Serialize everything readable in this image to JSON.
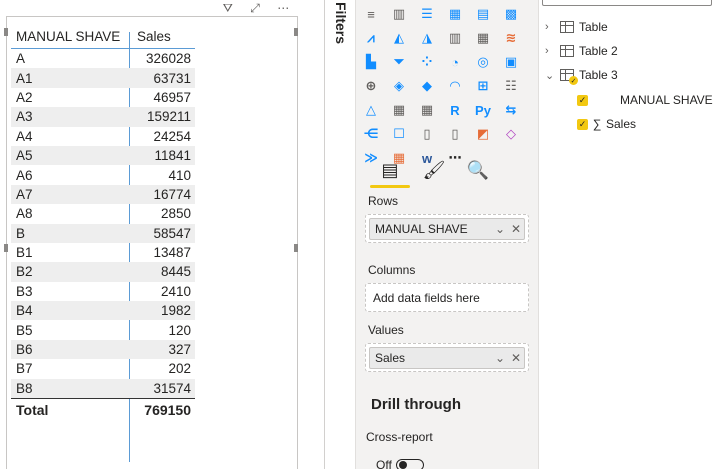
{
  "visual": {
    "header_icons": [
      {
        "icon": "filter-icon",
        "glyph": "⛛"
      },
      {
        "icon": "focus-mode-icon",
        "glyph": "⤢"
      },
      {
        "icon": "more-options-icon",
        "glyph": "⋯"
      }
    ]
  },
  "table": {
    "columns": [
      "MANUAL SHAVE",
      "Sales"
    ],
    "rows": [
      [
        "A",
        "326028"
      ],
      [
        "A1",
        "63731"
      ],
      [
        "A2",
        "46957"
      ],
      [
        "A3",
        "159211"
      ],
      [
        "A4",
        "24254"
      ],
      [
        "A5",
        "11841"
      ],
      [
        "A6",
        "410"
      ],
      [
        "A7",
        "16774"
      ],
      [
        "A8",
        "2850"
      ],
      [
        "B",
        "58547"
      ],
      [
        "B1",
        "13487"
      ],
      [
        "B2",
        "8445"
      ],
      [
        "B3",
        "2410"
      ],
      [
        "B4",
        "1982"
      ],
      [
        "B5",
        "120"
      ],
      [
        "B6",
        "327"
      ],
      [
        "B7",
        "202"
      ],
      [
        "B8",
        "31574"
      ]
    ],
    "total": {
      "label": "Total",
      "value": "769150"
    }
  },
  "filters": {
    "label": "Filters"
  },
  "visualizations": {
    "icons": [
      {
        "name": "stacked-bar-chart-icon",
        "glyph": "≡",
        "color": "#605e5c"
      },
      {
        "name": "stacked-column-chart-icon",
        "glyph": "▥",
        "color": "#605e5c"
      },
      {
        "name": "clustered-bar-chart-icon",
        "glyph": "☰",
        "color": "#118dff"
      },
      {
        "name": "clustered-column-chart-icon",
        "glyph": "▦",
        "color": "#118dff"
      },
      {
        "name": "100-bar-chart-icon",
        "glyph": "▤",
        "color": "#118dff"
      },
      {
        "name": "100-column-chart-icon",
        "glyph": "▩",
        "color": "#118dff"
      },
      {
        "name": "line-chart-icon",
        "glyph": "⩘",
        "color": "#118dff"
      },
      {
        "name": "area-chart-icon",
        "glyph": "◭",
        "color": "#118dff"
      },
      {
        "name": "stacked-area-chart-icon",
        "glyph": "◮",
        "color": "#118dff"
      },
      {
        "name": "line-column-chart-icon",
        "glyph": "▥",
        "color": "#605e5c"
      },
      {
        "name": "line-stacked-column-icon",
        "glyph": "▦",
        "color": "#605e5c"
      },
      {
        "name": "ribbon-chart-icon",
        "glyph": "≋",
        "color": "#e66c37"
      },
      {
        "name": "waterfall-chart-icon",
        "glyph": "▙",
        "color": "#118dff"
      },
      {
        "name": "funnel-chart-icon",
        "glyph": "⏷",
        "color": "#118dff"
      },
      {
        "name": "scatter-chart-icon",
        "glyph": "⁘",
        "color": "#118dff"
      },
      {
        "name": "pie-chart-icon",
        "glyph": "◔",
        "color": "#118dff"
      },
      {
        "name": "donut-chart-icon",
        "glyph": "◎",
        "color": "#118dff"
      },
      {
        "name": "treemap-icon",
        "glyph": "▣",
        "color": "#118dff"
      },
      {
        "name": "map-icon",
        "glyph": "⊕",
        "color": "#605e5c"
      },
      {
        "name": "filled-map-icon",
        "glyph": "◈",
        "color": "#118dff"
      },
      {
        "name": "shape-map-icon",
        "glyph": "◆",
        "color": "#118dff"
      },
      {
        "name": "gauge-icon",
        "glyph": "◠",
        "color": "#118dff"
      },
      {
        "name": "card-icon",
        "glyph": "⊞",
        "color": "#118dff"
      },
      {
        "name": "multi-row-card-icon",
        "glyph": "☷",
        "color": "#605e5c"
      },
      {
        "name": "kpi-icon",
        "glyph": "△",
        "color": "#118dff"
      },
      {
        "name": "slicer-icon",
        "glyph": "▦",
        "color": "#605e5c"
      },
      {
        "name": "table-icon",
        "glyph": "▦",
        "color": "#605e5c"
      },
      {
        "name": "r-visual-icon",
        "glyph": "R",
        "color": "#118dff"
      },
      {
        "name": "python-visual-icon",
        "glyph": "Py",
        "color": "#118dff"
      },
      {
        "name": "key-influencers-icon",
        "glyph": "⇆",
        "color": "#118dff"
      },
      {
        "name": "decomposition-tree-icon",
        "glyph": "⋲",
        "color": "#118dff"
      },
      {
        "name": "qna-icon",
        "glyph": "☐",
        "color": "#118dff"
      },
      {
        "name": "smart-narrative-icon",
        "glyph": "▯",
        "color": "#605e5c"
      },
      {
        "name": "paginated-report-icon",
        "glyph": "▯",
        "color": "#605e5c"
      },
      {
        "name": "arcgis-map-icon",
        "glyph": "◩",
        "color": "#e66c37"
      },
      {
        "name": "power-apps-icon",
        "glyph": "◇",
        "color": "#b146c2"
      },
      {
        "name": "power-automate-icon",
        "glyph": "≫",
        "color": "#118dff"
      },
      {
        "name": "custom-visual-icon",
        "glyph": "▦",
        "color": "#e66c37"
      },
      {
        "name": "word-visual-icon",
        "glyph": "w",
        "color": "#2b579a"
      },
      {
        "name": "get-more-visuals-icon",
        "glyph": "⋯",
        "color": "#252423"
      }
    ],
    "selected_icon": "table-icon",
    "tabs": [
      {
        "name": "fields-tab-icon",
        "glyph": "▤"
      },
      {
        "name": "format-tab-icon",
        "glyph": "🖌"
      },
      {
        "name": "analytics-tab-icon",
        "glyph": "🔍"
      }
    ],
    "rows_label": "Rows",
    "rows_field": "MANUAL SHAVE",
    "columns_label": "Columns",
    "columns_placeholder": "Add data fields here",
    "values_label": "Values",
    "values_field": "Sales",
    "drill_title": "Drill through",
    "cross_report_label": "Cross-report",
    "toggle_state": "Off"
  },
  "fields": {
    "tables": [
      {
        "label": "Table"
      },
      {
        "label": "Table 2"
      },
      {
        "label": "Table 3"
      }
    ],
    "table3_fields": [
      {
        "label": "MANUAL SHAVE",
        "sigma": ""
      },
      {
        "label": "Sales",
        "sigma": "∑"
      }
    ]
  },
  "colors": {
    "accent": "#f2c811",
    "grid_line": "#5b9bd5",
    "row_alt": "#eeeeee"
  }
}
